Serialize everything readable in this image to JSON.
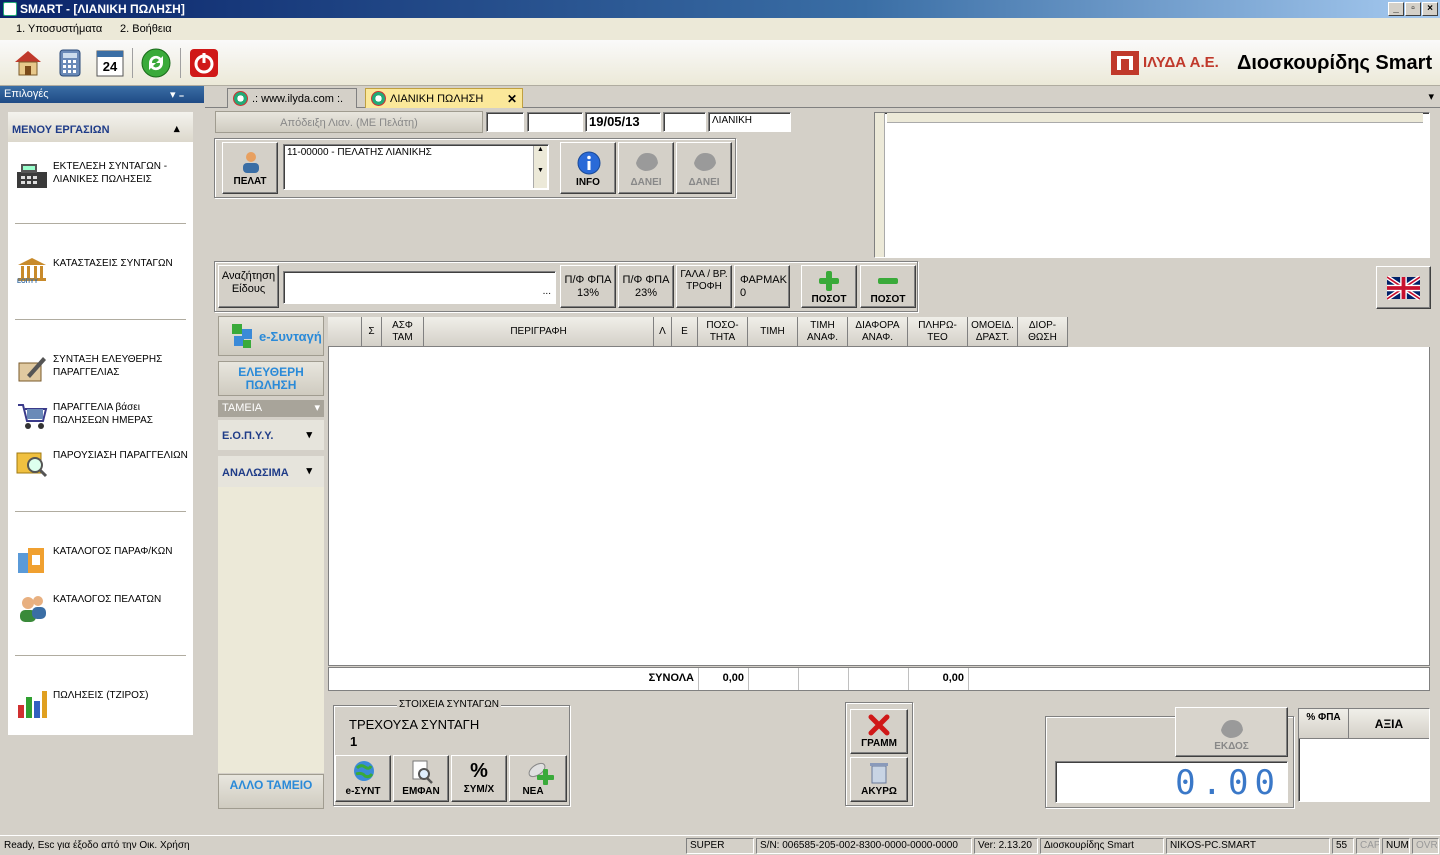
{
  "window": {
    "title": "SMART - [ΛΙΑΝΙΚΗ ΠΩΛΗΣΗ]",
    "btn_min": "_",
    "btn_restore": "▫",
    "btn_close": "×"
  },
  "menubar": {
    "item1": "1. Υποσυστήματα",
    "item2": "2. Βοήθεια"
  },
  "toolbar": {
    "calendar_day": "24",
    "logo_company": "ΙΛΥΔΑ Α.Ε.",
    "logo_product": "Διοσκουρίδης Smart"
  },
  "sidebar": {
    "header": "Επιλογές",
    "pin": "▾  ₌",
    "section_title": "ΜΕΝΟΥ ΕΡΓΑΣΙΩΝ",
    "section_toggle": "▴",
    "items": [
      {
        "label": "ΕΚΤΕΛΕΣΗ ΣΥΝΤΑΓΩΝ - ΛΙΑΝΙΚΕΣ ΠΩΛΗΣΕΙΣ"
      },
      {
        "label": "ΚΑΤΑΣΤΑΣΕΙΣ ΣΥΝΤΑΓΩΝ",
        "sub": "ΕΟΠΥΥ"
      },
      {
        "label": "ΣΥΝΤΑΞΗ ΕΛΕΥΘΕΡΗΣ ΠΑΡΑΓΓΕΛΙΑΣ"
      },
      {
        "label": "ΠΑΡΑΓΓΕΛΙΑ βάσει ΠΩΛΗΣΕΩΝ ΗΜΕΡΑΣ"
      },
      {
        "label": "ΠΑΡΟΥΣΙΑΣΗ ΠΑΡΑΓΓΕΛΙΩΝ"
      },
      {
        "label": "ΚΑΤΑΛΟΓΟΣ ΠΑΡΑΦ/ΚΩΝ"
      },
      {
        "label": "ΚΑΤΑΛΟΓΟΣ ΠΕΛΑΤΩΝ"
      },
      {
        "label": "ΠΩΛΗΣΕΙΣ (ΤΖΙΡΟΣ)"
      }
    ]
  },
  "tabs": {
    "tab1": ".: www.ilyda.com :.",
    "tab2": "ΛΙΑΝΙΚΗ ΠΩΛΗΣΗ",
    "close": "✕",
    "overflow": "▾"
  },
  "header_form": {
    "receipt_type": "Απόδειξη Λιαν. (ΜΕ Πελάτη)",
    "field1": "",
    "field2": "",
    "date": "19/05/13",
    "field4": "",
    "sale_type": "ΛΙΑΝΙΚΗ",
    "customer_btn": "ΠΕΛΑΤ",
    "customer_value": "11-00000 - ΠΕΛΑΤΗΣ ΛΙΑΝΙΚΗΣ",
    "info_btn": "INFO",
    "lend_btn1": "ΔΑΝΕΙ",
    "lend_btn2": "ΔΑΝΕΙ"
  },
  "search": {
    "label": "Αναζήτηση Είδους",
    "value": "",
    "ellipsis": "...",
    "pf13": "Π/Φ ΦΠΑ 13%",
    "pf23": "Π/Φ ΦΠΑ 23%",
    "gala": "ΓΑΛΑ / ΒΡ. ΤΡΟΦΗ",
    "farmak": "ΦΑΡΜΑΚ 0",
    "plus": "ΠΟΣΟΤ",
    "minus": "ΠΟΣΟΤ"
  },
  "leftpanel": {
    "esyntagi": "e-Συνταγή",
    "eleftheri": "ΕΛΕΥΘΕΡΗ ΠΩΛΗΣΗ",
    "tameia": "ΤΑΜΕΙΑ",
    "eopyy": "Ε.Ο.Π.Υ.Υ.",
    "analosima": "ΑΝΑΛΩΣΙΜΑ",
    "allo_tameio": "ΑΛΛΟ ΤΑΜΕΙΟ"
  },
  "grid": {
    "columns": [
      "Σ",
      "ΑΣΦ ΤΑΜ",
      "ΠΕΡΙΓΡΑΦΗ",
      "Λ",
      "Ε",
      "ΠΟΣΟ-ΤΗΤΑ",
      "ΤΙΜΗ",
      "ΤΙΜΗ ΑΝΑΦ.",
      "ΔΙΑΦΟΡΑ ΑΝΑΦ.",
      "ΠΛΗΡΩ-ΤΕΟ",
      "ΟΜΟΕΙΔ. ΔΡΑΣΤ.",
      "ΔΙΟΡ-ΘΩΣΗ"
    ],
    "rows": []
  },
  "totals": {
    "label": "ΣΥΝΟΛΑ",
    "quantity": "0,00",
    "payable": "0,00"
  },
  "prescription": {
    "group_title": "ΣΤΟΙΧΕΙΑ ΣΥΝΤΑΓΩΝ",
    "current": "ΤΡΕΧΟΥΣΑ ΣΥΝΤΑΓΗ",
    "number": "1",
    "btn_esynt": "e-ΣΥΝΤ",
    "btn_emfan": "ΕΜΦΑΝ",
    "btn_sym": "ΣΥΜ/Χ",
    "btn_nea": "ΝΕΑ"
  },
  "actions": {
    "gramm": "ΓΡΑΜΜ",
    "akyro": "ΑΚΥΡΩ",
    "ekdos": "ΕΚΔΟΣ"
  },
  "display": {
    "amount": "0.00"
  },
  "vat_table": {
    "col1": "% ΦΠΑ",
    "col2": "ΑΞΙΑ"
  },
  "statusbar": {
    "message": "Ready, Esc για έξοδο από την Οικ. Χρήση",
    "user": "SUPER",
    "serial": "S/N: 006585-205-002-8300-0000-0000-0000",
    "version": "Ver: 2.13.20",
    "product": "Διοσκουρίδης Smart",
    "machine": "NIKOS-PC.SMART",
    "code": "55",
    "cap": "CAP",
    "num": "NUM",
    "ovr": "OVR"
  },
  "colors": {
    "accent_blue": "#1f3c88",
    "title_blue": "#0a246a",
    "lcd_blue": "#3a78c8",
    "red": "#d01818",
    "green": "#2a9a2a"
  }
}
